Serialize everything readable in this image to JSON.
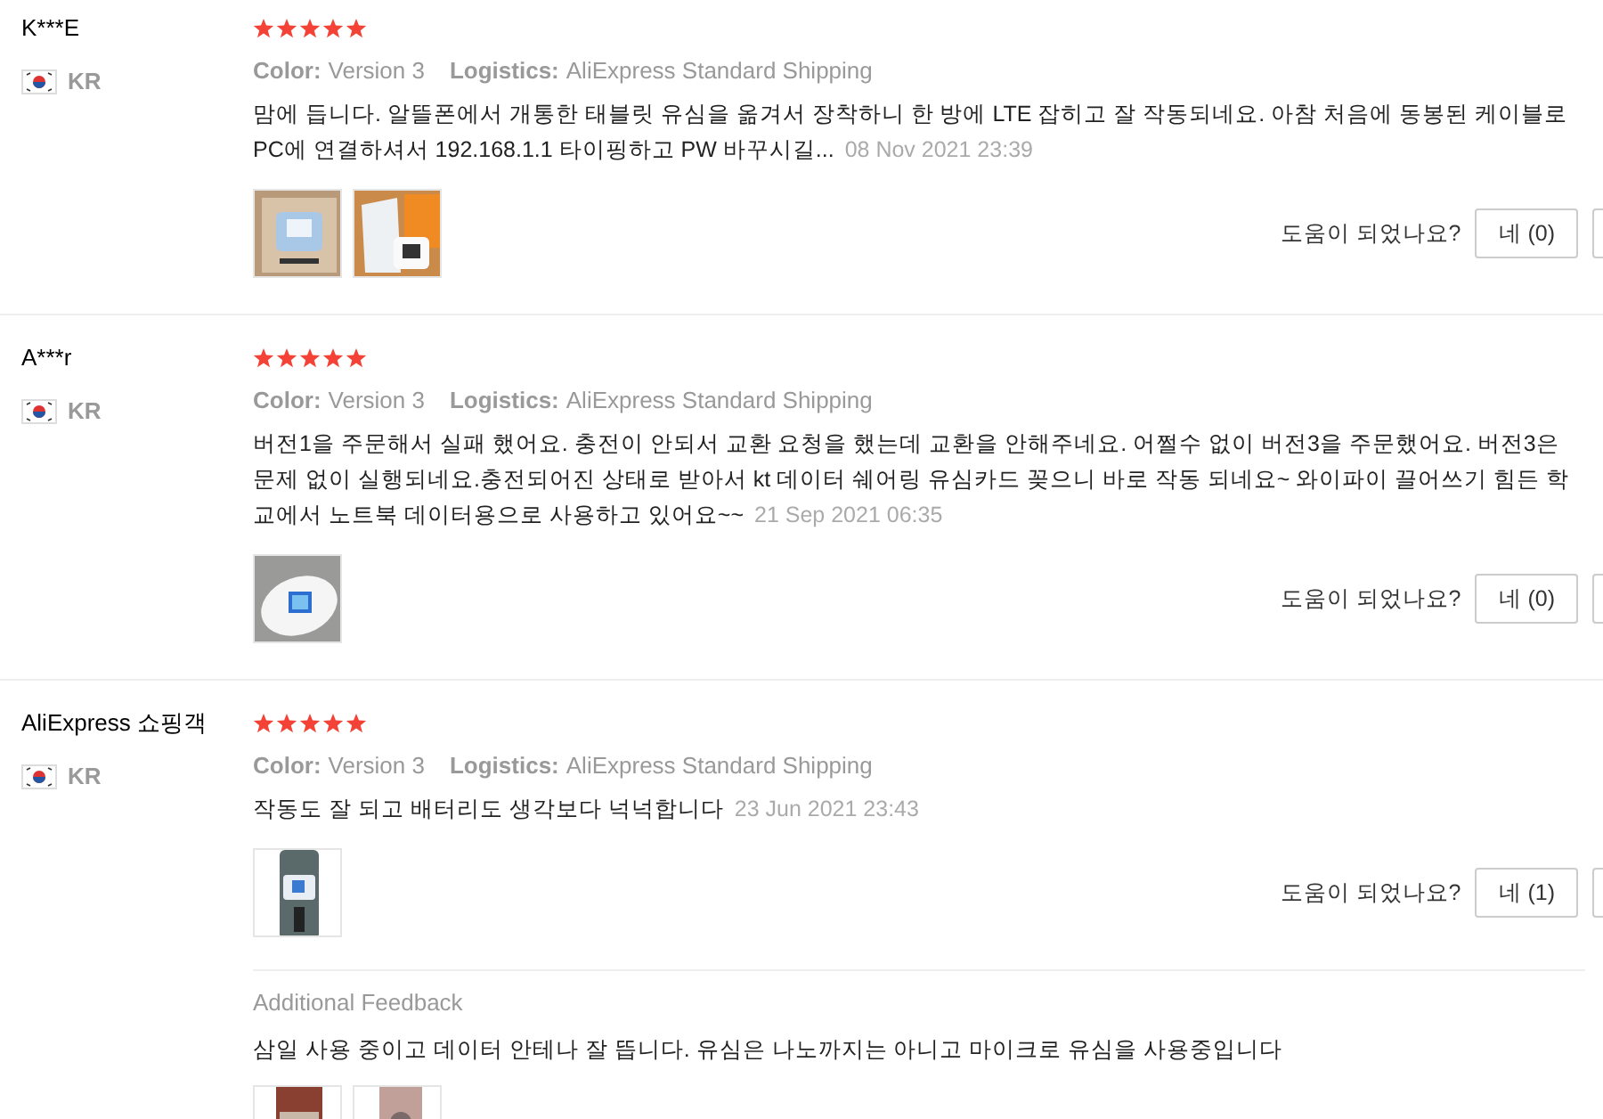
{
  "reviews": [
    {
      "name": "K***E",
      "country": "KR",
      "stars": 5,
      "color_label": "Color:",
      "color_value": "Version 3",
      "logistics_label": "Logistics:",
      "logistics_value": "AliExpress Standard Shipping",
      "text": "맘에 듭니다. 알뜰폰에서 개통한 태블릿 유심을 옮겨서 장착하니 한 방에 LTE 잡히고 잘 작동되네요. 아참 처음에 동봉된 케이블로 PC에 연결하셔서 192.168.1.1 타이핑하고 PW 바꾸시길...",
      "date": "08 Nov 2021 23:39",
      "photos": [
        {
          "kind": "picture"
        },
        {
          "kind": "picture"
        }
      ],
      "helpful_label": "도움이 되었나요?",
      "yes_button": "네 (0)"
    },
    {
      "name": "A***r",
      "country": "KR",
      "stars": 5,
      "color_label": "Color:",
      "color_value": "Version 3",
      "logistics_label": "Logistics:",
      "logistics_value": "AliExpress Standard Shipping",
      "text": "버전1을 주문해서 실패 했어요. 충전이 안되서 교환 요청을 했는데 교환을 안해주네요. 어쩔수 없이 버전3을 주문했어요. 버전3은 문제 없이 실행되네요.충전되어진 상태로 받아서 kt 데이터 쉐어링 유심카드 꽂으니 바로 작동 되네요~ 와이파이 끌어쓰기 힘든 학교에서 노트북 데이터용으로 사용하고 있어요~~",
      "date": "21 Sep 2021 06:35",
      "photos": [
        {
          "kind": "picture"
        }
      ],
      "helpful_label": "도움이 되었나요?",
      "yes_button": "네 (0)"
    },
    {
      "name": "AliExpress 쇼핑객",
      "country": "KR",
      "stars": 5,
      "color_label": "Color:",
      "color_value": "Version 3",
      "logistics_label": "Logistics:",
      "logistics_value": "AliExpress Standard Shipping",
      "text": "작동도 잘 되고 배터리도 생각보다 넉넉합니다",
      "date": "23 Jun 2021 23:43",
      "photos": [
        {
          "kind": "picture"
        }
      ],
      "helpful_label": "도움이 되었나요?",
      "yes_button": "네 (1)",
      "additional": {
        "title": "Additional Feedback",
        "text": "삼일 사용 중이고 데이터 안테나 잘 뜹니다. 유심은 나노까지는 아니고 마이크로 유심을 사용중입니다",
        "photos": [
          {
            "kind": "picture"
          },
          {
            "kind": "picture"
          }
        ]
      }
    }
  ]
}
